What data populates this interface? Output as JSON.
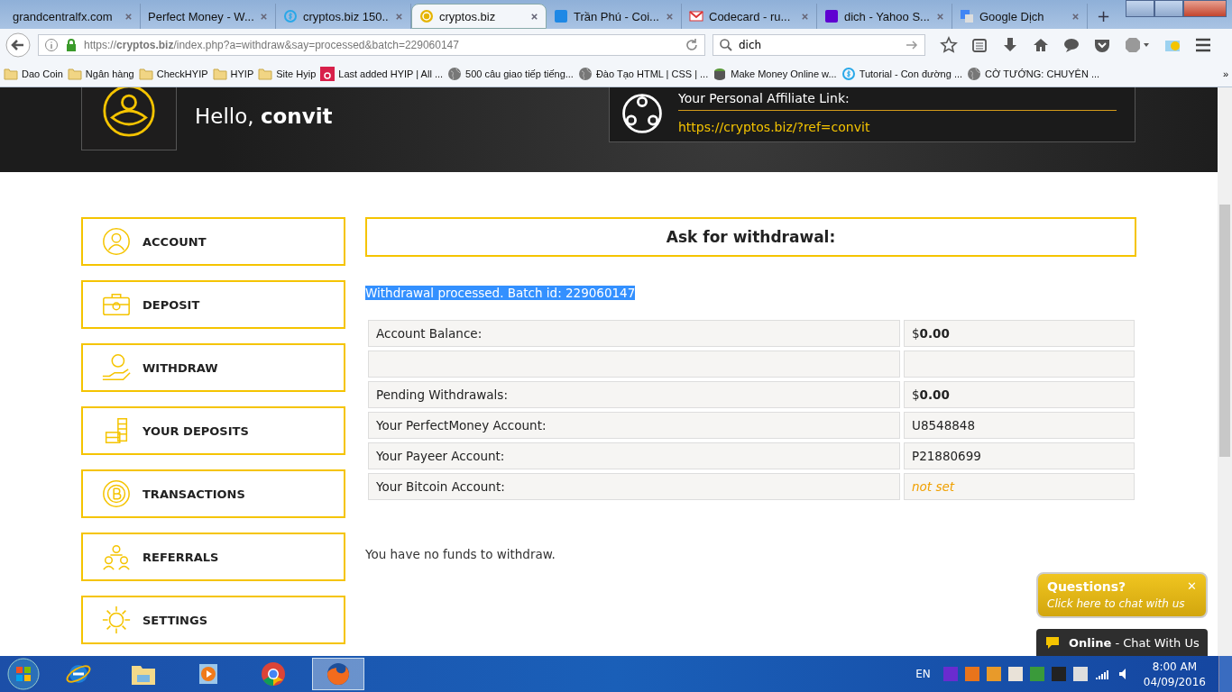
{
  "browser": {
    "tabs": [
      {
        "label": "grandcentralfx.com",
        "kind": "none",
        "selected": false
      },
      {
        "label": "Perfect Money - W...",
        "kind": "none",
        "selected": false
      },
      {
        "label": "cryptos.biz 150...",
        "kind": "ring",
        "selected": false
      },
      {
        "label": "cryptos.biz",
        "kind": "coin",
        "selected": true
      },
      {
        "label": "Trần Phú - Coi...",
        "kind": "square",
        "color": "#1e88e5",
        "selected": false
      },
      {
        "label": "Codecard - ru...",
        "kind": "mail",
        "selected": false
      },
      {
        "label": "dich - Yahoo S...",
        "kind": "square",
        "color": "#5f01d1",
        "selected": false
      },
      {
        "label": "Google Dịch",
        "kind": "translate",
        "selected": false
      }
    ],
    "new_tab": "+",
    "url": "https://**cryptos.biz**/index.php?a=withdraw&say=processed&batch=229060147",
    "search": "dich",
    "bookmarks": [
      {
        "label": "Dao Coin",
        "kind": "folder"
      },
      {
        "label": "Ngân hàng",
        "kind": "folder"
      },
      {
        "label": "CheckHYIP",
        "kind": "folder"
      },
      {
        "label": "HYIP",
        "kind": "folder"
      },
      {
        "label": "Site Hyip",
        "kind": "folder"
      },
      {
        "label": "Last added HYIP | All ...",
        "kind": "red"
      },
      {
        "label": "500 câu giao tiếp tiếng...",
        "kind": "globe"
      },
      {
        "label": "Đào Tạo HTML | CSS | ...",
        "kind": "globe"
      },
      {
        "label": "Make Money Online w...",
        "kind": "green"
      },
      {
        "label": "Tutorial - Con đường ...",
        "kind": "ring"
      },
      {
        "label": "CỜ TƯỚNG: CHUYÊN ...",
        "kind": "globe"
      }
    ],
    "bookmarks_more": "»"
  },
  "header": {
    "greeting": "Hello, **convit**",
    "affiliate_title": "Your Personal Affiliate Link:",
    "affiliate_link": "https://cryptos.biz/?ref=convit"
  },
  "menu": [
    {
      "label": "ACCOUNT",
      "kind": "user"
    },
    {
      "label": "DEPOSIT",
      "kind": "case"
    },
    {
      "label": "WITHDRAW",
      "kind": "hand"
    },
    {
      "label": "YOUR DEPOSITS",
      "kind": "stack"
    },
    {
      "label": "TRANSACTIONS",
      "kind": "coin"
    },
    {
      "label": "REFERRALS",
      "kind": "people"
    },
    {
      "label": "SETTINGS",
      "kind": "gear"
    }
  ],
  "panel": {
    "title": "Ask for withdrawal:",
    "status": {
      "text": "Withdrawal processed. Batch id: 229060147",
      "highlighted": true
    },
    "rows": [
      {
        "kind": "value",
        "label": "Account Balance:",
        "value": "$**0.00**"
      },
      {
        "kind": "blank"
      },
      {
        "kind": "value",
        "label": "Pending Withdrawals:",
        "value": "$**0.00**"
      },
      {
        "kind": "value",
        "label": "Your PerfectMoney Account:",
        "value": "U8548848"
      },
      {
        "kind": "value",
        "label": "Your Payeer Account:",
        "value": "P21880699"
      },
      {
        "kind": "unset",
        "label": "Your Bitcoin Account:",
        "value": "not set"
      }
    ],
    "message": "You have no funds to withdraw."
  },
  "chat": {
    "title": "Questions?",
    "close": "✕",
    "subtitle": "Click here to chat with us",
    "bar": "**Online** - Chat With Us"
  },
  "taskbar": {
    "apps": [
      {
        "kind": "ie",
        "selected": false
      },
      {
        "kind": "folder",
        "selected": false
      },
      {
        "kind": "media",
        "selected": false
      },
      {
        "kind": "chrome",
        "selected": false
      },
      {
        "kind": "firefox",
        "selected": true
      }
    ],
    "language": "EN",
    "time": "8:00 AM",
    "date": "04/09/2016"
  }
}
